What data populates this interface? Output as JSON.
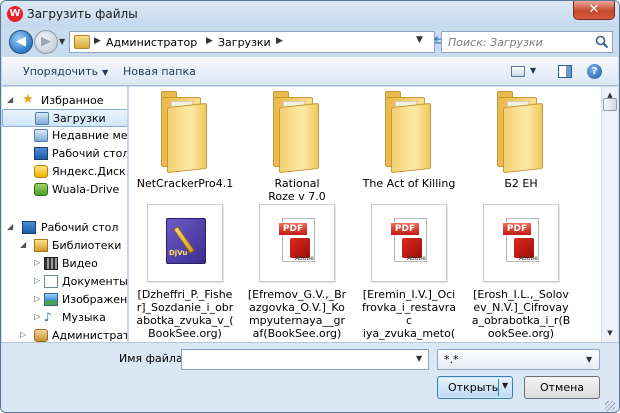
{
  "window": {
    "title": "Загрузить файлы",
    "app_icon_letter": "W",
    "close_glyph": "✕"
  },
  "nav": {
    "back_glyph": "◀",
    "forward_glyph": "▶",
    "breadcrumb": [
      "Администратор",
      "Загрузки"
    ],
    "search_placeholder": "Поиск: Загрузки"
  },
  "toolbar": {
    "organize_label": "Упорядочить",
    "new_folder_label": "Новая папка",
    "help_glyph": "?"
  },
  "sidebar": {
    "favorites_label": "Избранное",
    "favorites": [
      "Загрузки",
      "Недавние места",
      "Рабочий стол",
      "Яндекс.Диск",
      "Wuala-Drive"
    ],
    "desktop_label": "Рабочий стол",
    "libraries_label": "Библиотеки",
    "libraries": [
      "Видео",
      "Документы",
      "Изображения",
      "Музыка"
    ],
    "admin_label": "Администратор"
  },
  "files": [
    {
      "name": "NetCrackerPro4.1",
      "type": "folder"
    },
    {
      "name": "Rational Roze v 7.0",
      "type": "folder"
    },
    {
      "name": "The Act of Killing",
      "type": "folder"
    },
    {
      "name": "Б2 ЕН",
      "type": "folder"
    },
    {
      "name": "[Dzheffri_P._Fishe r]_Sozdanie_i_obr abotka_zvuka_v_( BookSee.org)",
      "type": "djvu"
    },
    {
      "name": "[Efremov_G.V.,_Br azgovka_O.V.]_Ko mpyuternaya__gr af(BookSee.org)",
      "type": "pdf"
    },
    {
      "name": "[Eremin_I.V.]_Oci frovka_i_restavrac iya_zvuka_meto( BookSee.org)",
      "type": "pdf"
    },
    {
      "name": "[Erosh_I.L.,_Solov ev_N.V.]_Cifrovay a_obrabotka_i_r(B ookSee.org)",
      "type": "pdf"
    }
  ],
  "icons": {
    "pdf_band": "PDF",
    "pdf_vendor": "Adobe",
    "djvu_label": "DjVu"
  },
  "bottom": {
    "filename_label": "Имя файла:",
    "filename_value": "",
    "filter_value": "*.*",
    "open_label": "Открыть",
    "cancel_label": "Отмена"
  }
}
